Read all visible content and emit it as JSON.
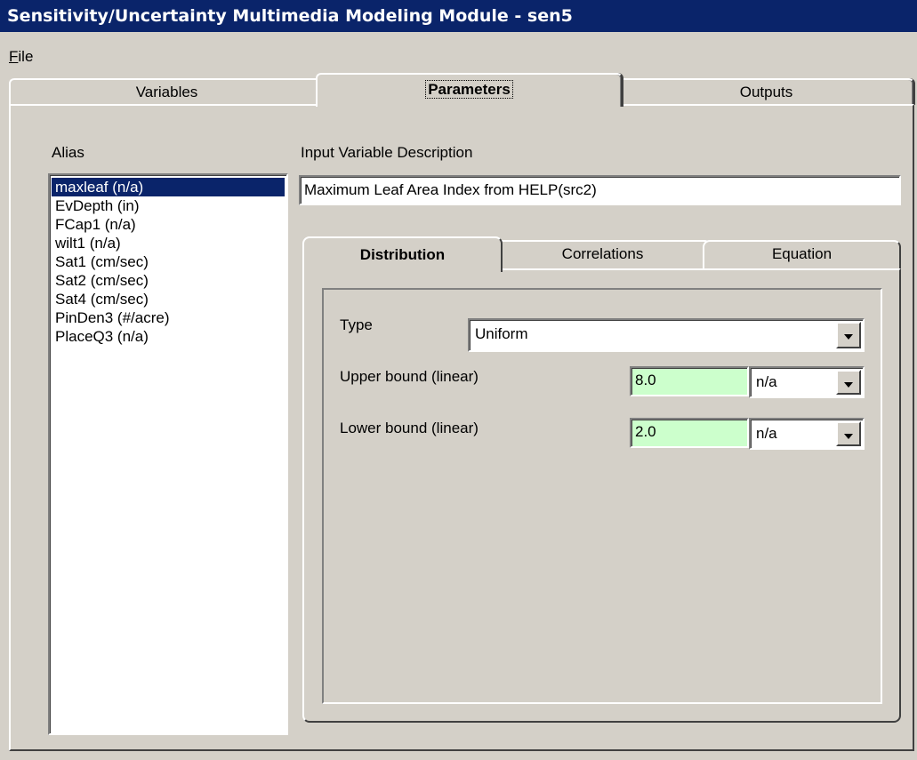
{
  "window": {
    "title": "Sensitivity/Uncertainty Multimedia Modeling Module - sen5"
  },
  "menu": {
    "file_label": "File"
  },
  "tabs": [
    {
      "label": "Variables",
      "active": false
    },
    {
      "label": "Parameters",
      "active": true
    },
    {
      "label": "Outputs",
      "active": false
    }
  ],
  "alias": {
    "label": "Alias",
    "items": [
      {
        "label": "maxleaf  (n/a)",
        "selected": true
      },
      {
        "label": "EvDepth  (in)",
        "selected": false
      },
      {
        "label": "FCap1  (n/a)",
        "selected": false
      },
      {
        "label": "wilt1  (n/a)",
        "selected": false
      },
      {
        "label": "Sat1  (cm/sec)",
        "selected": false
      },
      {
        "label": "Sat2  (cm/sec)",
        "selected": false
      },
      {
        "label": "Sat4  (cm/sec)",
        "selected": false
      },
      {
        "label": "PinDen3  (#/acre)",
        "selected": false
      },
      {
        "label": "PlaceQ3  (n/a)",
        "selected": false
      }
    ]
  },
  "description": {
    "label": "Input Variable Description",
    "value": "Maximum Leaf Area Index from HELP(src2)"
  },
  "inner_tabs": [
    {
      "label": "Distribution",
      "active": true
    },
    {
      "label": "Correlations",
      "active": false
    },
    {
      "label": "Equation",
      "active": false
    }
  ],
  "distribution": {
    "type_label": "Type",
    "type_value": "Uniform",
    "upper_label": "Upper bound (linear)",
    "upper_value": "8.0",
    "upper_unit": "n/a",
    "lower_label": "Lower bound (linear)",
    "lower_value": "2.0",
    "lower_unit": "n/a"
  },
  "colors": {
    "titlebar": "#0a246a",
    "face": "#d4d0c8",
    "input_highlight": "#ccffcc",
    "selection": "#0a246a"
  }
}
